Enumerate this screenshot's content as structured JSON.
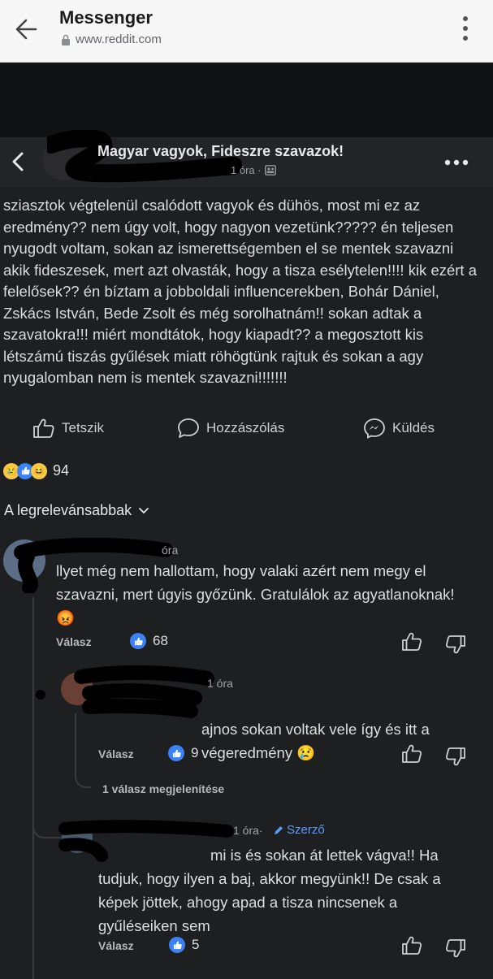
{
  "browser": {
    "title": "Messenger",
    "url": "www.reddit.com"
  },
  "post": {
    "group_name": "Magyar vagyok, Fideszre szavazok!",
    "time": "1 óra ·",
    "body": "sziasztok végtelenül csalódott vagyok és dühös, most mi ez az eredmény?? nem úgy volt, hogy nagyon vezetünk????? én teljesen nyugodt voltam, sokan az ismerettségemben el se mentek szavazni akik fideszesek, mert azt olvasták, hogy a tisza esélytelen!!!! kik ezért a felelősek?? én bíztam a jobboldali influencerekben, Bohár Dániel, Zskács István, Bede Zsolt és még sorolhatnám!! sokan adtak a szavatokra!!! miért mondtátok, hogy kiapadt?? a megosztott kis létszámú tiszás gyűlések miatt röhögtünk rajtuk és sokan a  agy nyugalomban nem is mentek szavazni!!!!!!!",
    "actions": {
      "like": "Tetszik",
      "comment": "Hozzászólás",
      "send": "Küldés"
    },
    "reaction_count": "94"
  },
  "comments": {
    "sort_label": "A legrelevánsabbak",
    "c1": {
      "time": "óra",
      "text": "llyet még nem hallottam, hogy valaki azért nem megy el szavazni, mert úgyis győzünk. Gratulálok az agyatlanoknak! 😡",
      "reply": "Válasz",
      "likes": "68"
    },
    "c2": {
      "time": "1 óra",
      "text": "ajnos sokan voltak vele így és itt a végeredmény 😢",
      "reply": "Válasz",
      "likes": "9",
      "more_replies": "1 válasz megjelenítése"
    },
    "c3": {
      "time": "1 óra·",
      "author_badge": "Szerző",
      "text": "mi is és sokan át lettek vágva!! Ha tudjuk, hogy ilyen a baj, akkor megyünk!! De csak a képek jöttek, ahogy apad a tisza nincsenek a gyűléseiken sem",
      "reply": "Válasz",
      "likes": "5"
    }
  }
}
